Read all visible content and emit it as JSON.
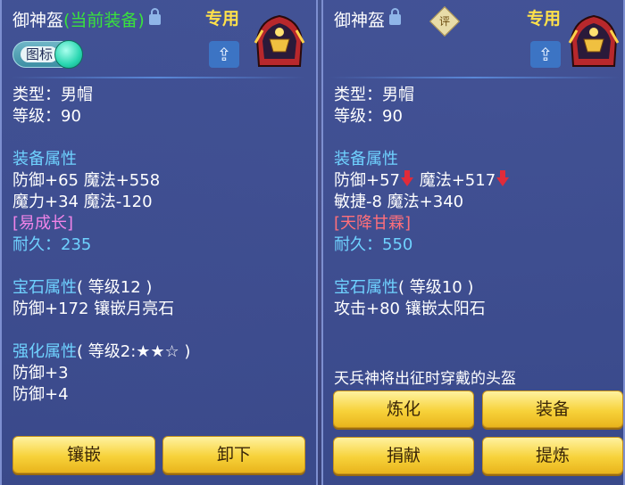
{
  "left": {
    "name": "御神盔",
    "equipped": "(当前装备)",
    "exclusive": "专用",
    "toggle_label": "图标",
    "type": "类型：男帽",
    "level": "等级：90",
    "equip_attr_title": "装备属性",
    "attr1": "防御+65 魔法+558",
    "attr2": "魔力+34 魔法-120",
    "special": "[易成长]",
    "durability_label": "耐久：",
    "durability_value": "235",
    "gem_title": "宝石属性",
    "gem_level": "( 等级12 )",
    "gem_attr": "防御+172 镶嵌月亮石",
    "enhance_title": "强化属性",
    "enhance_level": "( 等级2:★★☆ )",
    "enhance1": "防御+3",
    "enhance2": "防御+4",
    "buttons": [
      "镶嵌",
      "卸下"
    ]
  },
  "right": {
    "name": "御神盔",
    "rating_icon_text": "评",
    "exclusive": "专用",
    "type": "类型：男帽",
    "level": "等级：90",
    "equip_attr_title": "装备属性",
    "attr1a": "防御+57",
    "attr1b": " 魔法+517",
    "attr2": "敏捷-8 魔法+340",
    "special": "[天降甘霖]",
    "durability_label": "耐久：",
    "durability_value": "550",
    "gem_title": "宝石属性",
    "gem_level": "( 等级10 )",
    "gem_attr": "攻击+80 镶嵌太阳石",
    "description": "天兵神将出征时穿戴的头盔",
    "buttons": [
      "炼化",
      "装备",
      "捐献",
      "提炼"
    ]
  },
  "colors": {
    "gold_button": "#f7d23a",
    "attr_title": "#6fd2ff",
    "equipped_green": "#39e23c",
    "exclusive_yellow": "#ffe14a"
  }
}
